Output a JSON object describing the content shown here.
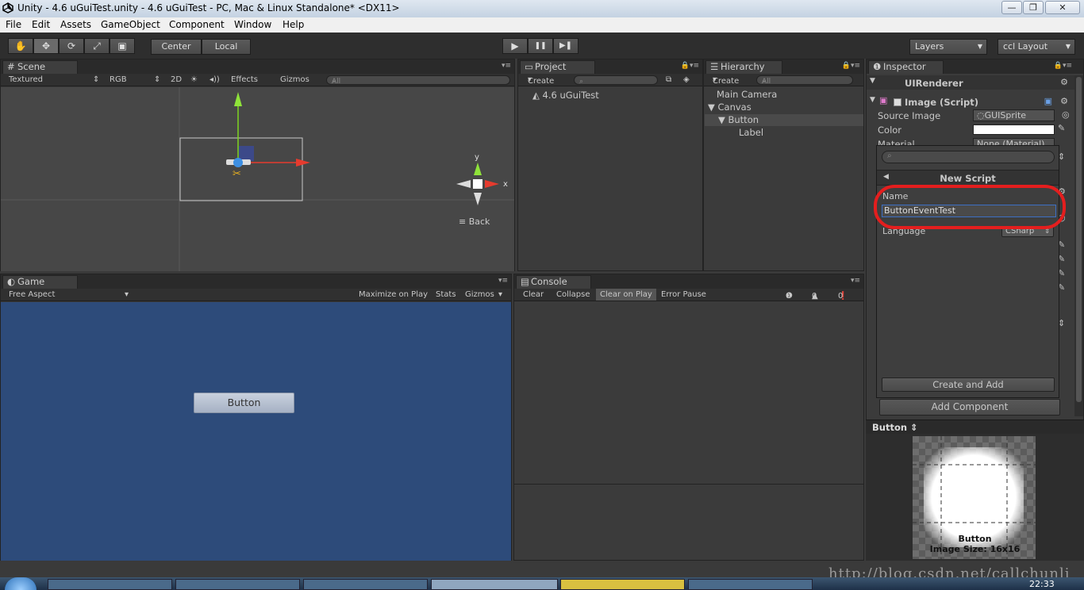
{
  "title_bar": {
    "title": "Unity - 4.6 uGuiTest.unity - 4.6 uGuiTest - PC, Mac & Linux Standalone* <DX11>",
    "minimize": "—",
    "maximize": "❐",
    "close": "✕"
  },
  "menu": [
    "File",
    "Edit",
    "Assets",
    "GameObject",
    "Component",
    "Window",
    "Help"
  ],
  "toolbar": {
    "pivot_mode": "Center",
    "pivot_rotation": "Local",
    "play": "▶",
    "pause": "❚❚",
    "step": "▶❚",
    "layers": "Layers",
    "layout": "ccl Layout"
  },
  "scene": {
    "tab": "Scene",
    "render_mode": "Textured",
    "color_mode": "RGB",
    "mode_2d": "2D",
    "effects": "Effects",
    "gizmos": "Gizmos",
    "search_placeholder": "All",
    "gizmo_y": "y",
    "gizmo_x": "x",
    "view_label": "Back"
  },
  "project": {
    "tab": "Project",
    "create": "Create",
    "item": "4.6 uGuiTest"
  },
  "hierarchy": {
    "tab": "Hierarchy",
    "create": "Create",
    "search_placeholder": "All",
    "items": [
      "Main Camera",
      "Canvas",
      "Button",
      "Label"
    ]
  },
  "game": {
    "tab": "Game",
    "aspect": "Free Aspect",
    "maximize": "Maximize on Play",
    "stats": "Stats",
    "gizmos": "Gizmos",
    "button_label": "Button",
    "bg_color": "#2d4b7a"
  },
  "console": {
    "tab": "Console",
    "clear": "Clear",
    "collapse": "Collapse",
    "clear_on_play": "Clear on Play",
    "error_pause": "Error Pause",
    "info_count": "0",
    "warn_count": "0",
    "error_count": "0"
  },
  "inspector": {
    "tab": "Inspector",
    "ui_renderer": "UIRenderer",
    "image_script": "Image (Script)",
    "source_image_label": "Source Image",
    "source_image_value": "GUISprite",
    "color_label": "Color",
    "material_label": "Material",
    "material_value": "None (Material)",
    "add_component": "Add Component",
    "preview_title": "Button",
    "preview_name": "Button",
    "preview_size": "Image Size: 16x16"
  },
  "new_script_popup": {
    "header": "New Script",
    "name_label": "Name",
    "name_value": "ButtonEventTest",
    "language_label": "Language",
    "language_value": "CSharp",
    "create_button": "Create and Add"
  },
  "watermark": "http://blog.csdn.net/callchunli",
  "taskbar": {
    "clock": "22:33"
  }
}
